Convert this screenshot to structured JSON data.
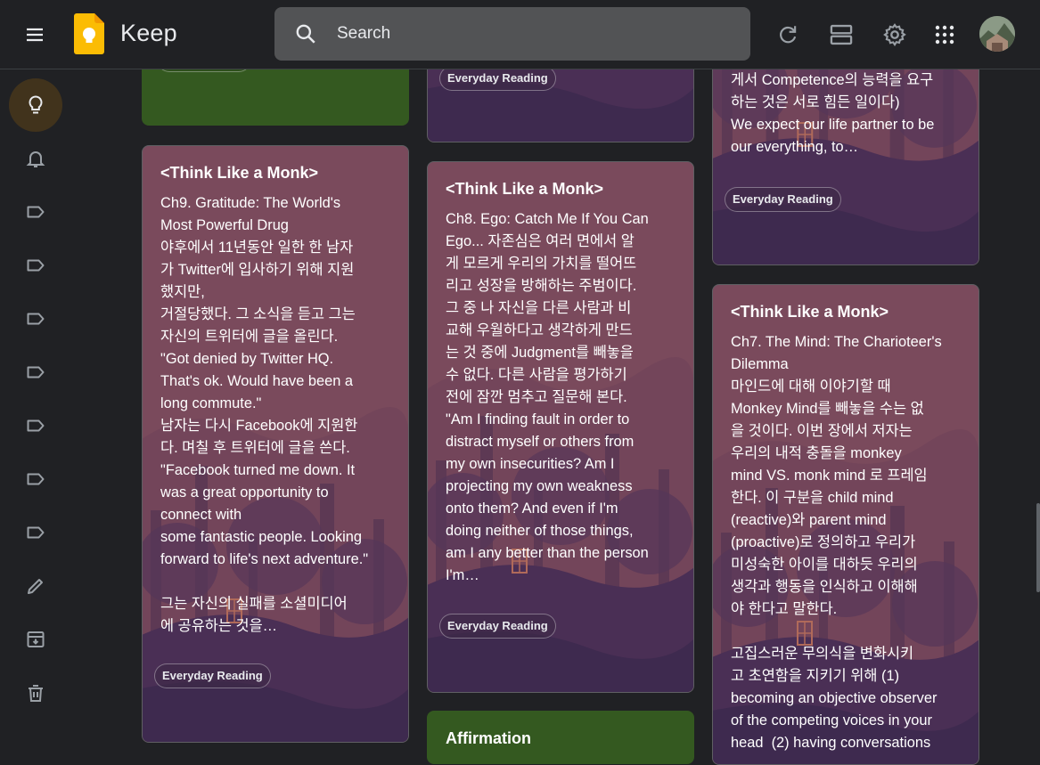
{
  "app": {
    "title": "Keep"
  },
  "search": {
    "placeholder": "Search"
  },
  "sidebar": {
    "items": [
      {
        "name": "notes",
        "icon": "lightbulb-icon",
        "active": true
      },
      {
        "name": "reminders",
        "icon": "bell-icon"
      },
      {
        "name": "label-1",
        "icon": "label-icon"
      },
      {
        "name": "label-2",
        "icon": "label-icon"
      },
      {
        "name": "label-3",
        "icon": "label-icon"
      },
      {
        "name": "label-4",
        "icon": "label-icon"
      },
      {
        "name": "label-5",
        "icon": "label-icon"
      },
      {
        "name": "label-6",
        "icon": "label-icon"
      },
      {
        "name": "label-7",
        "icon": "label-icon"
      },
      {
        "name": "edit-labels",
        "icon": "pencil-icon"
      },
      {
        "name": "archive",
        "icon": "archive-icon"
      },
      {
        "name": "trash",
        "icon": "trash-icon"
      }
    ]
  },
  "colors": {
    "theme_note": "#7a4a5c",
    "green_note": "#345920",
    "active_nav": "#41331c",
    "search_bg": "#525355"
  },
  "notes": {
    "col1_top": {
      "chip": ""
    },
    "col1_monk9": {
      "title": "<Think Like a Monk>",
      "body": "Ch9. Gratitude: The World's\nMost Powerful Drug\n야후에서 11년동안 일한 한 남자\n가 Twitter에 입사하기 위해 지원\n했지만,\n거절당했다. 그 소식을 듣고 그는\n자신의 트위터에 글을 올린다.\n\"Got denied by Twitter HQ.\nThat's ok. Would have been a\nlong commute.\"\n남자는 다시 Facebook에 지원한\n다. 며칠 후 트위터에 글을 쓴다.\n\"Facebook turned me down. It\nwas a great opportunity to\nconnect with\nsome fantastic people. Looking\nforward to life's next adventure.\"\n\n그는 자신의 실패를 소셜미디어\n에 공유하는 것을…",
      "chip": "Everyday Reading"
    },
    "col2_top": {
      "chip": "Everyday Reading"
    },
    "col2_monk8": {
      "title": "<Think Like a Monk>",
      "body": "Ch8. Ego: Catch Me If You Can\nEgo... 자존심은 여러 면에서 알\n게 모르게 우리의 가치를 떨어뜨\n리고 성장을 방해하는 주범이다.\n그 중 나 자신을 다른 사람과 비\n교해 우월하다고 생각하게 만드\n는 것 중에 Judgment를 빼놓을\n수 없다. 다른 사람을 평가하기\n전에 잠깐 멈추고 질문해 본다.\n\"Am I finding fault in order to\ndistract myself or others from\nmy own insecurities? Am I\nprojecting my own weakness\nonto them? And even if I'm\ndoing neither of those things,\nam I any better than the person\nI'm…",
      "chip": "Everyday Reading"
    },
    "col2_affirmation": {
      "title": "Affirmation"
    },
    "col3_top": {
      "body": "게서 Competence의 능력을 요구\n하는 것은 서로 힘든 일이다)\nWe expect our life partner to be\nour everything, to…",
      "chip": "Everyday Reading"
    },
    "col3_monk7": {
      "title": "<Think Like a Monk>",
      "body": "Ch7. The Mind: The Charioteer's\nDilemma\n마인드에 대해 이야기할 때\nMonkey Mind를 빼놓을 수는 없\n을 것이다. 이번 장에서 저자는\n우리의 내적 충돌을 monkey\nmind VS. monk mind 로 프레임\n한다. 이 구분을 child mind\n(reactive)와 parent mind\n(proactive)로 정의하고 우리가\n미성숙한 아이를 대하듯 우리의\n생각과 행동을 인식하고 이해해\n야 한다고 말한다.\n\n고집스러운 무의식을 변화시키\n고 초연함을 지키기 위해 (1)\nbecoming an objective observer\nof the competing voices in your\nhead  (2) having conversations"
    }
  }
}
